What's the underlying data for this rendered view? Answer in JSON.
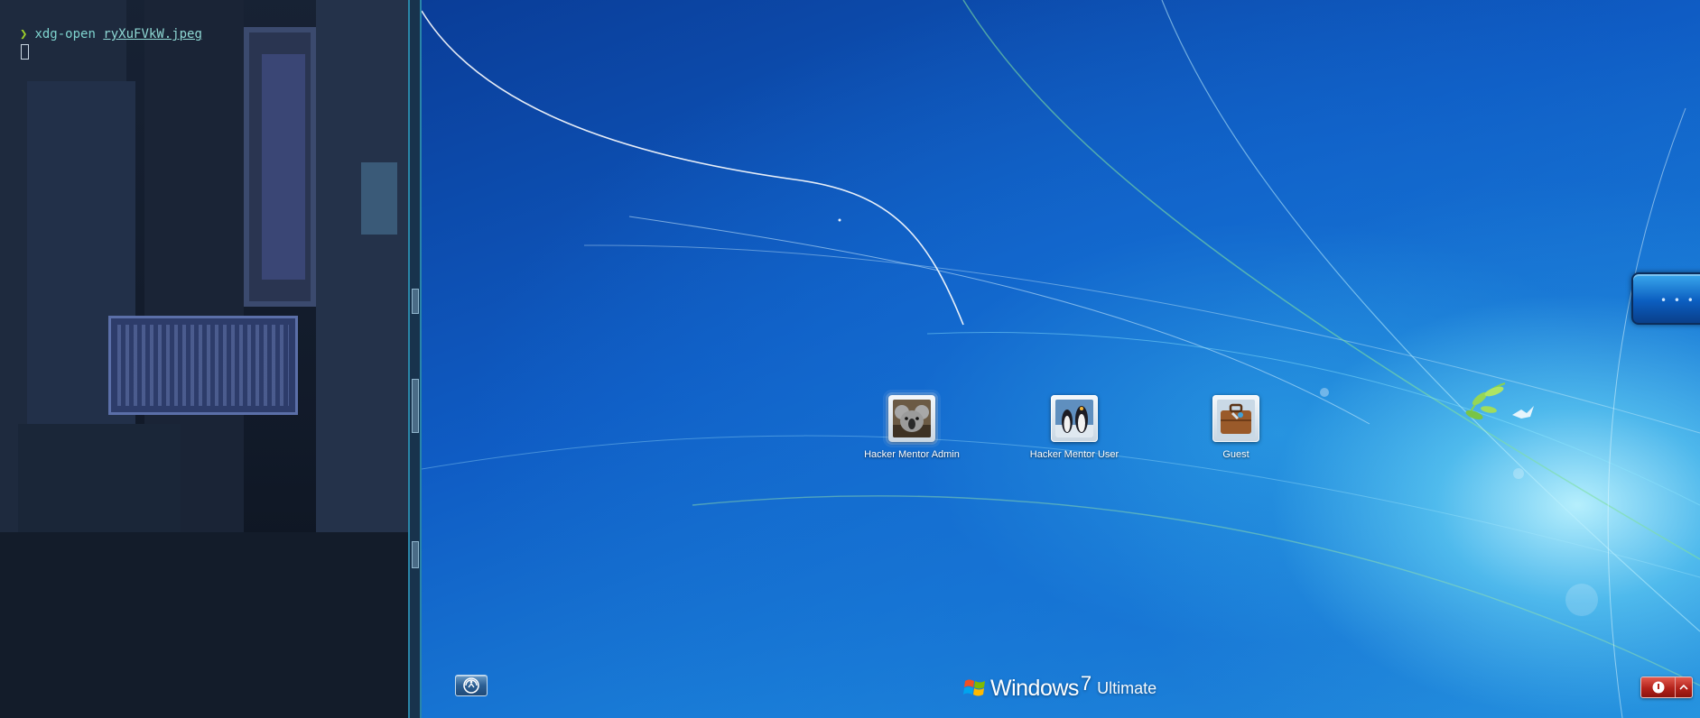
{
  "terminal": {
    "prompt_glyph": "❯",
    "command": "xdg-open",
    "argument": "ryXuFVkW.jpeg"
  },
  "login_screen": {
    "users": [
      {
        "name": "Hacker Mentor Admin",
        "picture": "koala-picture",
        "selected": true
      },
      {
        "name": "Hacker Mentor User",
        "picture": "penguins-picture",
        "selected": false
      },
      {
        "name": "Guest",
        "picture": "briefcase-picture",
        "selected": false
      }
    ],
    "branding": {
      "word": "Windows",
      "version": "7",
      "edition": "Ultimate"
    },
    "icons": {
      "ease_of_access": "ease-of-access-icon",
      "power": "power-icon",
      "power_options": "chevron-up-icon",
      "logo": "windows-flag-icon"
    },
    "side_widget_text": "• • •",
    "colors": {
      "background_top": "#0a3d98",
      "background_glow": "#bef5ff",
      "power_red": "#b3221a"
    }
  }
}
